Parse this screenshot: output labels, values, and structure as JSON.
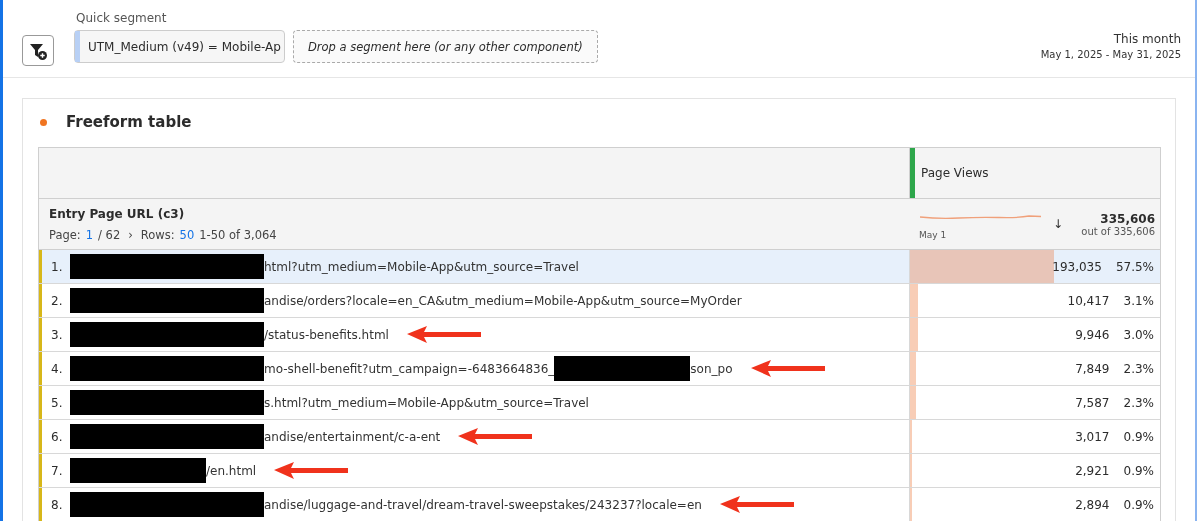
{
  "segment_bar": {
    "label": "Quick segment",
    "segments": [
      {
        "kind": "segment",
        "text": "UTM_Medium (v49) = Mobile-Ap"
      },
      {
        "kind": "dropzone",
        "text": "Drop a segment here (or any other component)"
      }
    ]
  },
  "date_range": {
    "preset": "This month",
    "range": "May 1, 2025 - May 31, 2025"
  },
  "panel": {
    "title": "Freeform table"
  },
  "table": {
    "dimension": "Entry Page URL (c3)",
    "pagination": {
      "page_label": "Page:",
      "page": "1",
      "pages": "/ 62",
      "next": "›",
      "rows_label": "Rows:",
      "rows": "50",
      "range": "1-50 of 3,064"
    },
    "metric": {
      "name": "Page Views",
      "sparkline_label": "May 1",
      "sort": "↓",
      "total": "335,606",
      "total_of": "out of 335,606"
    },
    "rows": [
      {
        "index": "1.",
        "selected": true,
        "annotated": false,
        "level": 0.575,
        "value": "193,035",
        "percent": "57.5%",
        "parts": [
          {
            "kind": "redaction"
          },
          {
            "kind": "text",
            "text": "html?utm_medium=Mobile-App&utm_source=Travel"
          }
        ]
      },
      {
        "index": "2.",
        "selected": false,
        "annotated": false,
        "level": 0.031,
        "value": "10,417",
        "percent": "3.1%",
        "parts": [
          {
            "kind": "redaction"
          },
          {
            "kind": "text",
            "text": "andise/orders?locale=en_CA&utm_medium=Mobile-App&utm_source=MyOrder"
          }
        ]
      },
      {
        "index": "3.",
        "selected": false,
        "annotated": true,
        "level": 0.03,
        "value": "9,946",
        "percent": "3.0%",
        "parts": [
          {
            "kind": "redaction"
          },
          {
            "kind": "text",
            "text": "/status-benefits.html"
          }
        ]
      },
      {
        "index": "4.",
        "selected": false,
        "annotated": true,
        "level": 0.023,
        "value": "7,849",
        "percent": "2.3%",
        "parts": [
          {
            "kind": "redaction"
          },
          {
            "kind": "text",
            "text": "mo-shell-benefit?utm_campaign=-6483664836_"
          },
          {
            "kind": "short_redaction"
          },
          {
            "kind": "text",
            "text": "son_po"
          }
        ]
      },
      {
        "index": "5.",
        "selected": false,
        "annotated": false,
        "level": 0.023,
        "value": "7,587",
        "percent": "2.3%",
        "parts": [
          {
            "kind": "redaction"
          },
          {
            "kind": "text",
            "text": "s.html?utm_medium=Mobile-App&utm_source=Travel"
          }
        ]
      },
      {
        "index": "6.",
        "selected": false,
        "annotated": true,
        "level": 0.009,
        "value": "3,017",
        "percent": "0.9%",
        "parts": [
          {
            "kind": "redaction"
          },
          {
            "kind": "text",
            "text": "andise/entertainment/c-a-ent"
          }
        ]
      },
      {
        "index": "7.",
        "selected": false,
        "annotated": true,
        "level": 0.009,
        "value": "2,921",
        "percent": "0.9%",
        "parts": [
          {
            "kind": "short_redaction"
          },
          {
            "kind": "text",
            "text": "/en.html"
          }
        ]
      },
      {
        "index": "8.",
        "selected": false,
        "annotated": true,
        "level": 0.009,
        "value": "2,894",
        "percent": "0.9%",
        "parts": [
          {
            "kind": "redaction"
          },
          {
            "kind": "text",
            "text": "andise/luggage-and-travel/dream-travel-sweepstakes/243237?locale=en"
          }
        ]
      }
    ]
  }
}
